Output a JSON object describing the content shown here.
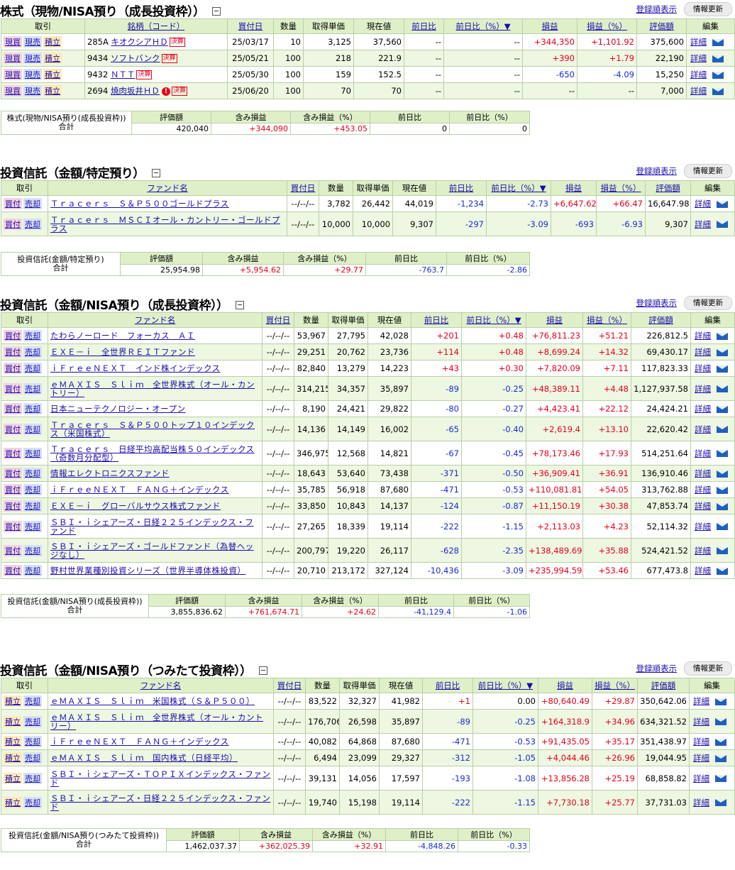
{
  "common": {
    "order_link": "登録順表示",
    "refresh": "情報更新",
    "detail": "詳細",
    "dash": "--",
    "date_dash": "--/--/--",
    "buy": "買付",
    "sell": "売却",
    "tsumitate": "積立",
    "genbai": "現買",
    "genuri": "現売"
  },
  "section1": {
    "title": "株式（現物/NISA預り（成長投資枠））",
    "headers": [
      "取引",
      "銘柄（コード）",
      "買付日",
      "数量",
      "取得単価",
      "現在値",
      "前日比",
      "前日比（%）▼",
      "損益",
      "損益（%）",
      "評価額",
      "編集"
    ],
    "rows": [
      {
        "code": "285A",
        "name": "キオクシアＨＤ",
        "badge": "決算",
        "alert": "",
        "date": "25/03/17",
        "qty": "10",
        "cost": "3,125",
        "price": "37,560",
        "chg": "--",
        "chgp": "--",
        "pl": "+344,350",
        "plp": "+1,101.92",
        "val": "375,600"
      },
      {
        "code": "9434",
        "name": "ソフトバンク",
        "badge": "決算",
        "alert": "",
        "date": "25/05/21",
        "qty": "100",
        "cost": "218",
        "price": "221.9",
        "chg": "--",
        "chgp": "--",
        "pl": "+390",
        "plp": "+1.79",
        "val": "22,190"
      },
      {
        "code": "9432",
        "name": "ＮＴＴ",
        "badge": "決算",
        "alert": "",
        "date": "25/05/30",
        "qty": "100",
        "cost": "159",
        "price": "152.5",
        "chg": "--",
        "chgp": "--",
        "pl": "-650",
        "plp": "-4.09",
        "val": "15,250"
      },
      {
        "code": "2694",
        "name": "焼肉坂井ＨＤ",
        "badge": "決算",
        "alert": "!",
        "date": "25/06/20",
        "qty": "100",
        "cost": "70",
        "price": "70",
        "chg": "--",
        "chgp": "--",
        "pl": "--",
        "plp": "--",
        "val": "7,000"
      }
    ],
    "summary": {
      "label1": "株式(現物/NISA預り(成長投資枠))",
      "label2": "合計",
      "headers": [
        "評価額",
        "含み損益",
        "含み損益（%）",
        "前日比",
        "前日比（%）"
      ],
      "values": [
        "420,040",
        "+344,090",
        "+453.05",
        "0",
        "0"
      ]
    }
  },
  "section2": {
    "title": "投資信託（金額/特定預り）",
    "headers": [
      "取引",
      "ファンド名",
      "買付日",
      "数量",
      "取得単価",
      "現在値",
      "前日比",
      "前日比（%）▼",
      "損益",
      "損益（%）",
      "評価額",
      "編集"
    ],
    "rows": [
      {
        "name": "Ｔｒａｃｅｒｓ　Ｓ＆Ｐ５００ゴールドプラス",
        "qty": "3,782",
        "cost": "26,442",
        "price": "44,019",
        "chg": "-1,234",
        "chgp": "-2.73",
        "pl": "+6,647.62",
        "plp": "+66.47",
        "val": "16,647.98"
      },
      {
        "name": "Ｔｒａｃｅｒｓ　ＭＳＣＩオール・カントリー・ゴールドプラス",
        "qty": "10,000",
        "cost": "10,000",
        "price": "9,307",
        "chg": "-297",
        "chgp": "-3.09",
        "pl": "-693",
        "plp": "-6.93",
        "val": "9,307"
      }
    ],
    "summary": {
      "label1": "投資信託(金額/特定預り)",
      "label2": "合計",
      "headers": [
        "評価額",
        "含み損益",
        "含み損益（%）",
        "前日比",
        "前日比（%）"
      ],
      "values": [
        "25,954.98",
        "+5,954.62",
        "+29.77",
        "-763.7",
        "-2.86"
      ]
    }
  },
  "section3": {
    "title": "投資信託（金額/NISA預り（成長投資枠））",
    "headers": [
      "取引",
      "ファンド名",
      "買付日",
      "数量",
      "取得単価",
      "現在値",
      "前日比",
      "前日比（%）▼",
      "損益",
      "損益（%）",
      "評価額",
      "編集"
    ],
    "rows": [
      {
        "name": "たわらノーロード　フォーカス　ＡＩ",
        "qty": "53,967",
        "cost": "27,795",
        "price": "42,028",
        "chg": "+201",
        "chgp": "+0.48",
        "pl": "+76,811.23",
        "plp": "+51.21",
        "val": "226,812.5"
      },
      {
        "name": "ＥＸＥ－ｉ　全世界ＲＥＩＴファンド",
        "qty": "29,251",
        "cost": "20,762",
        "price": "23,736",
        "chg": "+114",
        "chgp": "+0.48",
        "pl": "+8,699.24",
        "plp": "+14.32",
        "val": "69,430.17"
      },
      {
        "name": "ｉＦｒｅｅＮＥＸＴ　インド株インデックス",
        "qty": "82,840",
        "cost": "13,279",
        "price": "14,223",
        "chg": "+43",
        "chgp": "+0.30",
        "pl": "+7,820.09",
        "plp": "+7.11",
        "val": "117,823.33"
      },
      {
        "name": "ｅＭＡＸＩＳ　Ｓｌｉｍ　全世界株式（オール・カントリー）",
        "qty": "314,215",
        "cost": "34,357",
        "price": "35,897",
        "chg": "-89",
        "chgp": "-0.25",
        "pl": "+48,389.11",
        "plp": "+4.48",
        "val": "1,127,937.58"
      },
      {
        "name": "日本ニューテクノロジー・オープン",
        "qty": "8,190",
        "cost": "24,421",
        "price": "29,822",
        "chg": "-80",
        "chgp": "-0.27",
        "pl": "+4,423.41",
        "plp": "+22.12",
        "val": "24,424.21"
      },
      {
        "name": "Ｔｒａｃｅｒｓ　Ｓ＆Ｐ５００トップ１０インデックス（米国株式）",
        "qty": "14,136",
        "cost": "14,149",
        "price": "16,002",
        "chg": "-65",
        "chgp": "-0.40",
        "pl": "+2,619.4",
        "plp": "+13.10",
        "val": "22,620.42"
      },
      {
        "name": "Ｔｒａｃｅｒｓ　日経平均高配当株５０インデックス（奇数月分配型）",
        "qty": "346,975",
        "cost": "12,568",
        "price": "14,821",
        "chg": "-67",
        "chgp": "-0.45",
        "pl": "+78,173.46",
        "plp": "+17.93",
        "val": "514,251.64"
      },
      {
        "name": "情報エレクトロニクスファンド",
        "qty": "18,643",
        "cost": "53,640",
        "price": "73,438",
        "chg": "-371",
        "chgp": "-0.50",
        "pl": "+36,909.41",
        "plp": "+36.91",
        "val": "136,910.46"
      },
      {
        "name": "ｉＦｒｅｅＮＥＸＴ　ＦＡＮＧ＋インデックス",
        "qty": "35,785",
        "cost": "56,918",
        "price": "87,680",
        "chg": "-471",
        "chgp": "-0.53",
        "pl": "+110,081.81",
        "plp": "+54.05",
        "val": "313,762.88"
      },
      {
        "name": "ＥＸＥ－ｉ　グローバルサウス株式ファンド",
        "qty": "33,850",
        "cost": "10,843",
        "price": "14,137",
        "chg": "-124",
        "chgp": "-0.87",
        "pl": "+11,150.19",
        "plp": "+30.38",
        "val": "47,853.74"
      },
      {
        "name": "ＳＢＩ・ｉシェアーズ・日経２２５インデックス・ファンド",
        "qty": "27,265",
        "cost": "18,339",
        "price": "19,114",
        "chg": "-222",
        "chgp": "-1.15",
        "pl": "+2,113.03",
        "plp": "+4.23",
        "val": "52,114.32"
      },
      {
        "name": "ＳＢＩ・ｉシェアーズ・ゴールドファンド（為替ヘッジなし）",
        "qty": "200,797",
        "cost": "19,220",
        "price": "26,117",
        "chg": "-628",
        "chgp": "-2.35",
        "pl": "+138,489.69",
        "plp": "+35.88",
        "val": "524,421.52"
      },
      {
        "name": "野村世界業種別投資シリーズ（世界半導体株投資）",
        "qty": "20,710",
        "cost": "213,172",
        "price": "327,124",
        "chg": "-10,436",
        "chgp": "-3.09",
        "pl": "+235,994.59",
        "plp": "+53.46",
        "val": "677,473.8"
      }
    ],
    "summary": {
      "label1": "投資信託(金額/NISA預り(成長投資枠))",
      "label2": "合計",
      "headers": [
        "評価額",
        "含み損益",
        "含み損益（%）",
        "前日比",
        "前日比（%）"
      ],
      "values": [
        "3,855,836.62",
        "+761,674.71",
        "+24.62",
        "-41,129.4",
        "-1.06"
      ]
    }
  },
  "section4": {
    "title": "投資信託（金額/NISA預り（つみたて投資枠））",
    "headers": [
      "取引",
      "ファンド名",
      "買付日",
      "数量",
      "取得単価",
      "現在値",
      "前日比",
      "前日比（%）▼",
      "損益",
      "損益（%）",
      "評価額",
      "編集"
    ],
    "rows": [
      {
        "name": "ｅＭＡＸＩＳ　Ｓｌｉｍ　米国株式（Ｓ＆Ｐ５００）",
        "qty": "83,522",
        "cost": "32,327",
        "price": "41,982",
        "chg": "+1",
        "chgp": "0.00",
        "pl": "+80,640.49",
        "plp": "+29.87",
        "val": "350,642.06"
      },
      {
        "name": "ｅＭＡＸＩＳ　Ｓｌｉｍ　全世界株式（オール・カントリー）",
        "qty": "176,706",
        "cost": "26,598",
        "price": "35,897",
        "chg": "-89",
        "chgp": "-0.25",
        "pl": "+164,318.9",
        "plp": "+34.96",
        "val": "634,321.52"
      },
      {
        "name": "ｉＦｒｅｅＮＥＸＴ　ＦＡＮＧ＋インデックス",
        "qty": "40,082",
        "cost": "64,868",
        "price": "87,680",
        "chg": "-471",
        "chgp": "-0.53",
        "pl": "+91,435.05",
        "plp": "+35.17",
        "val": "351,438.97"
      },
      {
        "name": "ｅＭＡＸＩＳ　Ｓｌｉｍ　国内株式（日経平均）",
        "qty": "6,494",
        "cost": "23,099",
        "price": "29,327",
        "chg": "-312",
        "chgp": "-1.05",
        "pl": "+4,044.46",
        "plp": "+26.96",
        "val": "19,044.95"
      },
      {
        "name": "ＳＢＩ・ｉシェアーズ・ＴＯＰＩＸインデックス・ファンド",
        "qty": "39,131",
        "cost": "14,056",
        "price": "17,597",
        "chg": "-193",
        "chgp": "-1.08",
        "pl": "+13,856.28",
        "plp": "+25.19",
        "val": "68,858.82"
      },
      {
        "name": "ＳＢＩ・ｉシェアーズ・日経２２５インデックス・ファンド",
        "qty": "19,740",
        "cost": "15,198",
        "price": "19,114",
        "chg": "-222",
        "chgp": "-1.15",
        "pl": "+7,730.18",
        "plp": "+25.77",
        "val": "37,731.03"
      }
    ],
    "summary": {
      "label1": "投資信託(金額/NISA預り(つみたて投資枠))",
      "label2": "合計",
      "headers": [
        "評価額",
        "含み損益",
        "含み損益（%）",
        "前日比",
        "前日比（%）"
      ],
      "values": [
        "1,462,037.37",
        "+362,025.39",
        "+32.91",
        "-4,848.26",
        "-0.33"
      ]
    }
  },
  "colors": {
    "positive": "#e8001c",
    "negative": "#1a2bd0",
    "header_bg": "#dff0c9",
    "alt_row": "#eef7e1",
    "link": "#1a0dab"
  }
}
